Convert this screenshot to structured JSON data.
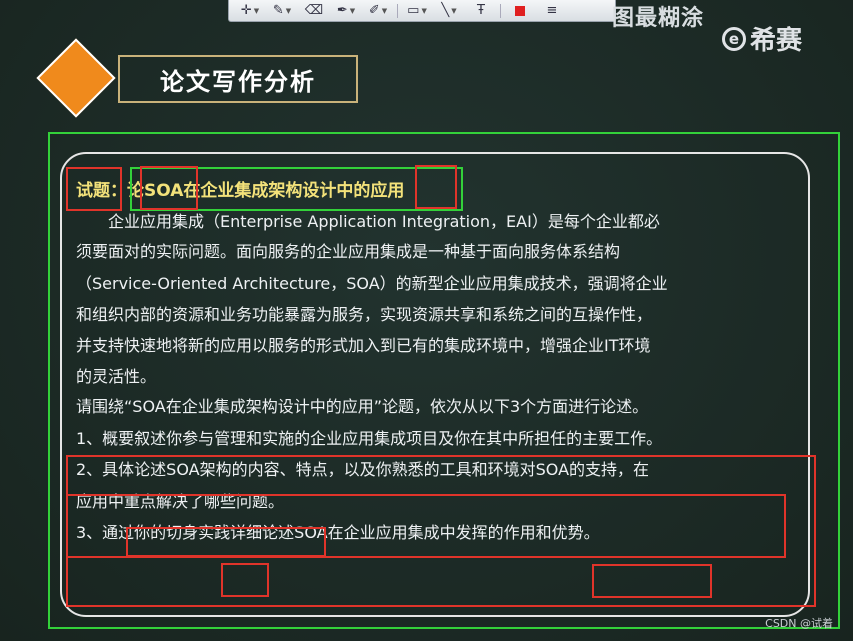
{
  "toolbar": {
    "icons": [
      "crosshair-icon",
      "pencil-icon",
      "eraser-icon",
      "pen-icon",
      "highlighter-icon",
      "rectangle-icon",
      "line-icon",
      "text-icon",
      "color-icon",
      "line-width-icon"
    ]
  },
  "brand": {
    "top_text": "图最糊涂",
    "logo_letter": "e",
    "name": "希赛"
  },
  "section_title": "论文写作分析",
  "topic": {
    "label": "试题：",
    "title": "论SOA在企业集成架构设计中的应用"
  },
  "paragraphs": [
    "　　企业应用集成（Enterprise Application Integration，EAI）是每个企业都必",
    "须要面对的实际问题。面向服务的企业应用集成是一种基于面向服务体系结构",
    "（Service-Oriented Architecture，SOA）的新型企业应用集成技术，强调将企业",
    "和组织内部的资源和业务功能暴露为服务，实现资源共享和系统之间的互操作性，",
    "并支持快速地将新的应用以服务的形式加入到已有的集成环境中，增强企业IT环境",
    "的灵活性。",
    "请围绕“SOA在企业集成架构设计中的应用”论题，依次从以下3个方面进行论述。",
    "1、概要叙述你参与管理和实施的企业应用集成项目及你在其中所担任的主要工作。",
    "2、具体论述SOA架构的内容、特点，以及你熟悉的工具和环境对SOA的支持，在",
    "应用中重点解决了哪些问题。",
    "3、通过你的切身实践详细论述SOA在企业应用集成中发挥的作用和优势。"
  ],
  "watermark": "CSDN @试着",
  "colors": {
    "accent_orange": "#f08a1c",
    "annotation_red": "#e0342a",
    "annotation_green": "#33d13a",
    "topic_yellow": "#f3e27a"
  }
}
